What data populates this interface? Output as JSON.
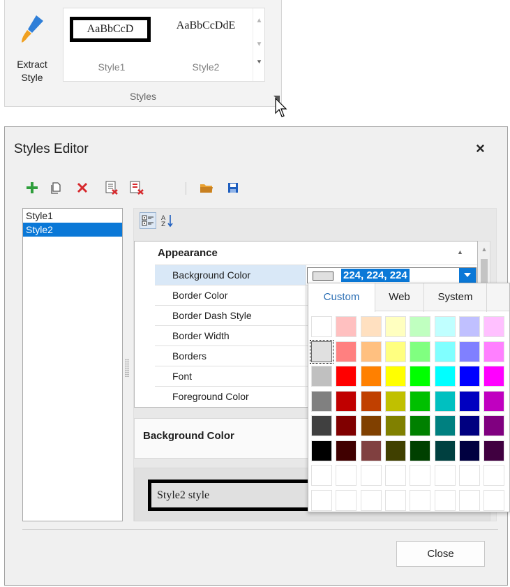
{
  "ribbon": {
    "extract_style_label": "Extract\nStyle",
    "gallery": [
      {
        "preview": "AaBbCcD",
        "caption": "Style1"
      },
      {
        "preview": "AaBbCcDdE",
        "caption": "Style2"
      }
    ],
    "group_label": "Styles"
  },
  "dialog": {
    "title": "Styles Editor",
    "close_x": "×",
    "toolbar_icons": [
      "plus-icon",
      "copy-icon",
      "delete-icon",
      "apply-icon",
      "remove-all-icon",
      "open-folder-icon",
      "save-icon"
    ],
    "styles": [
      {
        "name": "Style1",
        "selected": false
      },
      {
        "name": "Style2",
        "selected": true
      }
    ],
    "grid": {
      "category": "Appearance",
      "rows": [
        {
          "name": "Background Color",
          "selected": true
        },
        {
          "name": "Border Color"
        },
        {
          "name": "Border Dash Style"
        },
        {
          "name": "Border Width"
        },
        {
          "name": "Borders"
        },
        {
          "name": "Font"
        },
        {
          "name": "Foreground Color"
        }
      ],
      "edit_value": "224, 224, 224"
    },
    "description_title": "Background Color",
    "preview_text": "Style2 style",
    "close_button": "Close"
  },
  "color_popup": {
    "tabs": [
      {
        "label": "Custom",
        "active": true
      },
      {
        "label": "Web",
        "active": false
      },
      {
        "label": "System",
        "active": false
      }
    ],
    "rows": [
      [
        "#ffffff",
        "#ffc0c0",
        "#ffe0c0",
        "#ffffc0",
        "#c0ffc0",
        "#c0ffff",
        "#c0c0ff",
        "#ffc0ff"
      ],
      [
        "#e0e0e0",
        "#ff8080",
        "#ffc080",
        "#ffff80",
        "#80ff80",
        "#80ffff",
        "#8080ff",
        "#ff80ff"
      ],
      [
        "#c0c0c0",
        "#ff0000",
        "#ff8000",
        "#ffff00",
        "#00ff00",
        "#00ffff",
        "#0000ff",
        "#ff00ff"
      ],
      [
        "#808080",
        "#c00000",
        "#c04000",
        "#c0c000",
        "#00c000",
        "#00c0c0",
        "#0000c0",
        "#c000c0"
      ],
      [
        "#404040",
        "#800000",
        "#804000",
        "#808000",
        "#008000",
        "#008080",
        "#000080",
        "#800080"
      ],
      [
        "#000000",
        "#400000",
        "#804040",
        "#404000",
        "#004000",
        "#004040",
        "#000040",
        "#400040"
      ],
      [
        "#ffffff",
        "#ffffff",
        "#ffffff",
        "#ffffff",
        "#ffffff",
        "#ffffff",
        "#ffffff",
        "#ffffff"
      ],
      [
        "#ffffff",
        "#ffffff",
        "#ffffff",
        "#ffffff",
        "#ffffff",
        "#ffffff",
        "#ffffff",
        "#ffffff"
      ]
    ],
    "selected_color": "#e0e0e0"
  },
  "colors": {
    "accent": "#0a78d7",
    "selection_row": "#d9e8f7"
  }
}
